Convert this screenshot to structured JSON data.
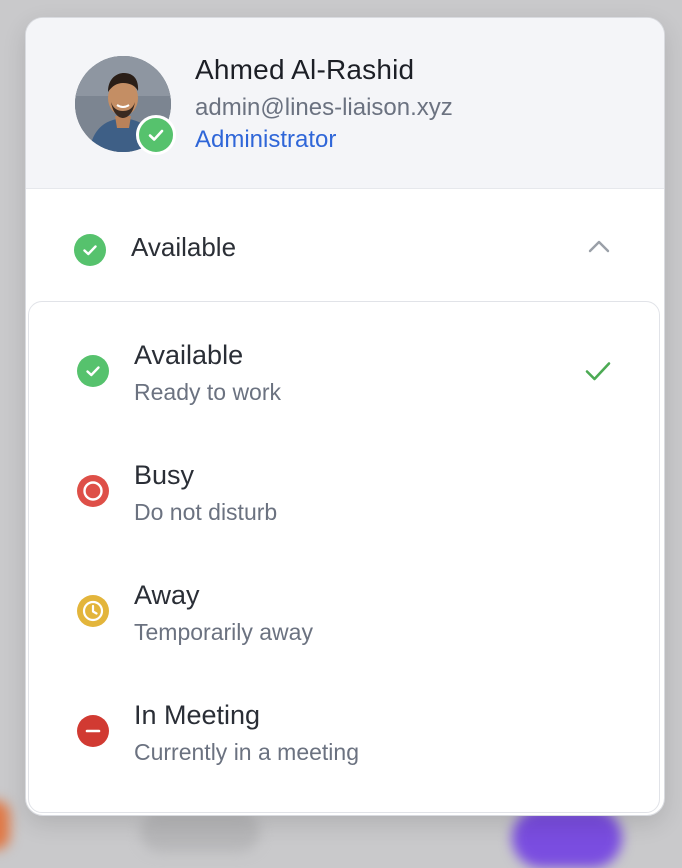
{
  "user": {
    "name": "Ahmed Al-Rashid",
    "email": "admin@lines-liaison.xyz",
    "role": "Administrator",
    "presence_icon": "check-badge-icon"
  },
  "current_status": {
    "label": "Available",
    "icon": "check-circle-icon",
    "toggle_icon": "chevron-up-icon"
  },
  "options": [
    {
      "title": "Available",
      "subtitle": "Ready to work",
      "icon": "check-circle-icon",
      "color": "#56c26d",
      "selected": true
    },
    {
      "title": "Busy",
      "subtitle": "Do not disturb",
      "icon": "busy-ring-icon",
      "color": "#de4f48",
      "selected": false
    },
    {
      "title": "Away",
      "subtitle": "Temporarily away",
      "icon": "clock-icon",
      "color": "#e3b53b",
      "selected": false
    },
    {
      "title": "In Meeting",
      "subtitle": "Currently in a meeting",
      "icon": "minus-circle-icon",
      "color": "#d13a32",
      "selected": false
    }
  ],
  "colors": {
    "accent_blue": "#2f66d8",
    "selected_check": "#4caa54",
    "header_bg": "#f4f5f8"
  }
}
